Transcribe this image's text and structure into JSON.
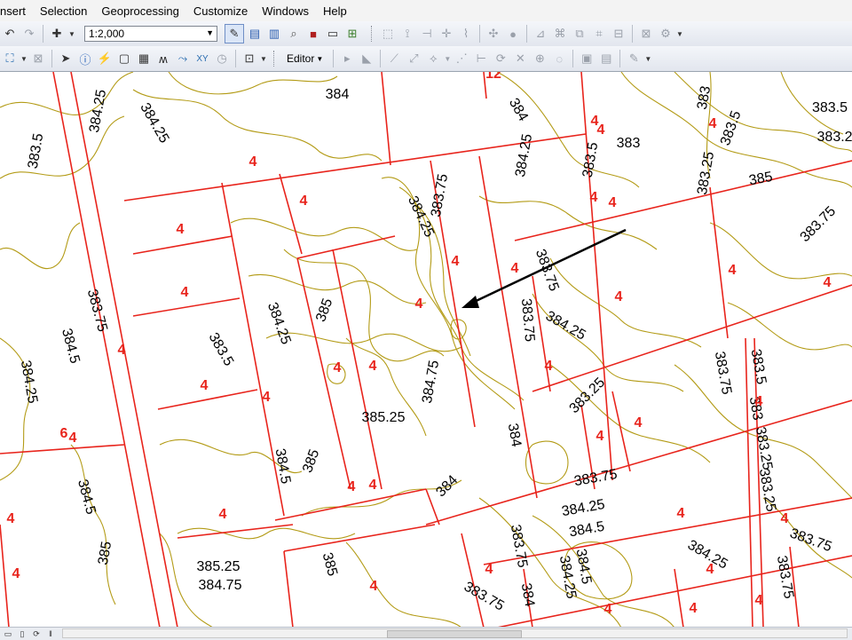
{
  "menu": {
    "items": [
      "nsert",
      "Selection",
      "Geoprocessing",
      "Customize",
      "Windows",
      "Help"
    ]
  },
  "toolbar": {
    "scale_value": "1:2,000",
    "editor_label": "Editor"
  },
  "map": {
    "contour_labels": [
      "384.25",
      "384.25",
      "383.5",
      "384",
      "384",
      "384.25",
      "383.5",
      "383",
      "383.5",
      "383",
      "383.5",
      "383.25",
      "383.25",
      "385",
      "384.25",
      "383.75",
      "383.75",
      "383.75",
      "383.75",
      "384.5",
      "384.25",
      "385",
      "384.25",
      "383.75",
      "383.5",
      "384.25",
      "383.75",
      "383.5",
      "383.25",
      "384",
      "384.75",
      "385.25",
      "385",
      "384.5",
      "384.5",
      "384",
      "383",
      "383.25",
      "383.25",
      "383.75",
      "384.5",
      "384.25",
      "384.25",
      "385",
      "385",
      "385.25",
      "384.75",
      "384.5",
      "383.75",
      "384",
      "383.75",
      "384.25",
      "383.75",
      "383.75"
    ],
    "parcel_labels": [
      "4",
      "4",
      "4",
      "4",
      "4",
      "4",
      "4",
      "4",
      "4",
      "4",
      "4",
      "4",
      "4",
      "4",
      "4",
      "4",
      "4",
      "12",
      "6",
      "4",
      "4",
      "4",
      "4",
      "4",
      "4",
      "4",
      "4",
      "4",
      "4",
      "4",
      "4",
      "4",
      "4",
      "4",
      "4",
      "4",
      "4",
      "4",
      "4",
      "4"
    ],
    "colors": {
      "parcel_line": "#e8241c",
      "contour_line": "#b39b16",
      "parcel_label": "#e8241c",
      "contour_label": "#000000",
      "arrow": "#000000"
    }
  },
  "icons": {
    "toolbar1": [
      "undo-icon",
      "redo-icon",
      "add-data-icon",
      "scale-dropdown-icon",
      "editor-toolbar-icon",
      "table-of-contents-icon",
      "catalog-icon",
      "search-icon",
      "arctoolbox-icon",
      "python-icon",
      "model-builder-icon"
    ],
    "toolbar2": [
      "georeference-icon",
      "select-elements-icon",
      "identify-icon",
      "hyperlink-icon",
      "html-popup-icon",
      "measure-icon",
      "find-icon",
      "find-route-icon",
      "go-to-xy-icon",
      "time-slider-icon"
    ],
    "status": [
      "data-view-icon",
      "layout-view-icon",
      "refresh-icon",
      "pause-icon"
    ]
  }
}
